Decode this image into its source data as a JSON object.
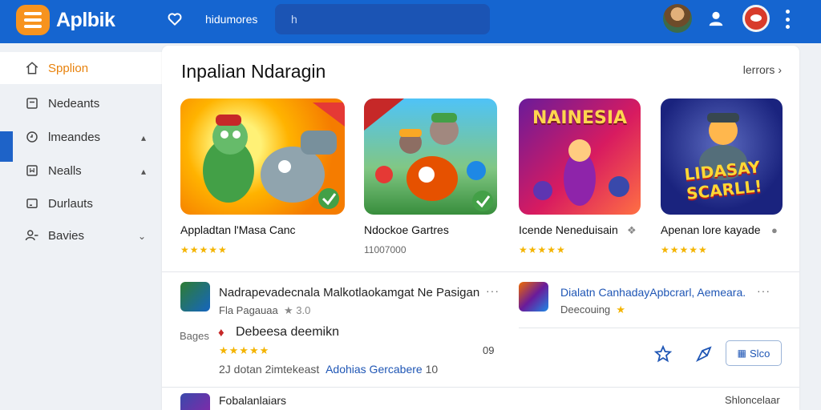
{
  "header": {
    "app_name": "Aplbik",
    "nav_link": "hidumores",
    "search_value": "h",
    "brand_color": "#1565d0",
    "icons": [
      "menu-icon",
      "heart-icon",
      "user-icon",
      "more-vertical-icon"
    ]
  },
  "sidebar": {
    "items": [
      {
        "label": "Spplion",
        "icon": "home-icon",
        "active": true
      },
      {
        "label": "Nedeants",
        "icon": "inbox-icon"
      },
      {
        "label": "lmeandes",
        "icon": "clock-icon",
        "chevron": "▴"
      },
      {
        "label": "Nealls",
        "icon": "bookmark-icon",
        "chevron": "▴"
      },
      {
        "label": "Durlauts",
        "icon": "square-icon"
      },
      {
        "label": "Bavies",
        "icon": "people-icon",
        "chevron": "⌄"
      }
    ],
    "accent_color": "#e8820c"
  },
  "featured": {
    "title": "Inpalian Ndaragin",
    "more_label": "lerrors",
    "cards": [
      {
        "name": "Appladtan l'Masa Canc",
        "rating": "★★★★★"
      },
      {
        "name": "Ndockoe Gartres",
        "rating": "11007000"
      },
      {
        "name": "Icende Neneduisain",
        "rating": "★★★★★",
        "banner": "NAINESIA"
      },
      {
        "name": "Apenan lore kayade",
        "rating": "★★★★★",
        "banner": "LIDASAY SCARLL!"
      }
    ]
  },
  "list": {
    "row1": {
      "title": "Nadrapevadecnala  Malkotlaokamgat Ne Pasigan",
      "sub_label": "Fla Pagauaa",
      "sub_value": "★ 3.0"
    },
    "row1_right": {
      "title": "Dialatn CanhadayApbcrarl, Aemeara.",
      "sub_label": "Deecouing",
      "sub_value": "★"
    },
    "row2": {
      "side_label": "Bages",
      "title": "Debeesa deemikn",
      "rating": "★★★★★",
      "count": "09",
      "meta_prefix": "2J dotan 2imtekeast",
      "meta_link": "Adohias Gercabere",
      "meta_suffix": "10",
      "button_label": "Slco"
    },
    "row3": {
      "title": "Fobalanlaiars",
      "right_label": "Shloncelaar"
    }
  }
}
